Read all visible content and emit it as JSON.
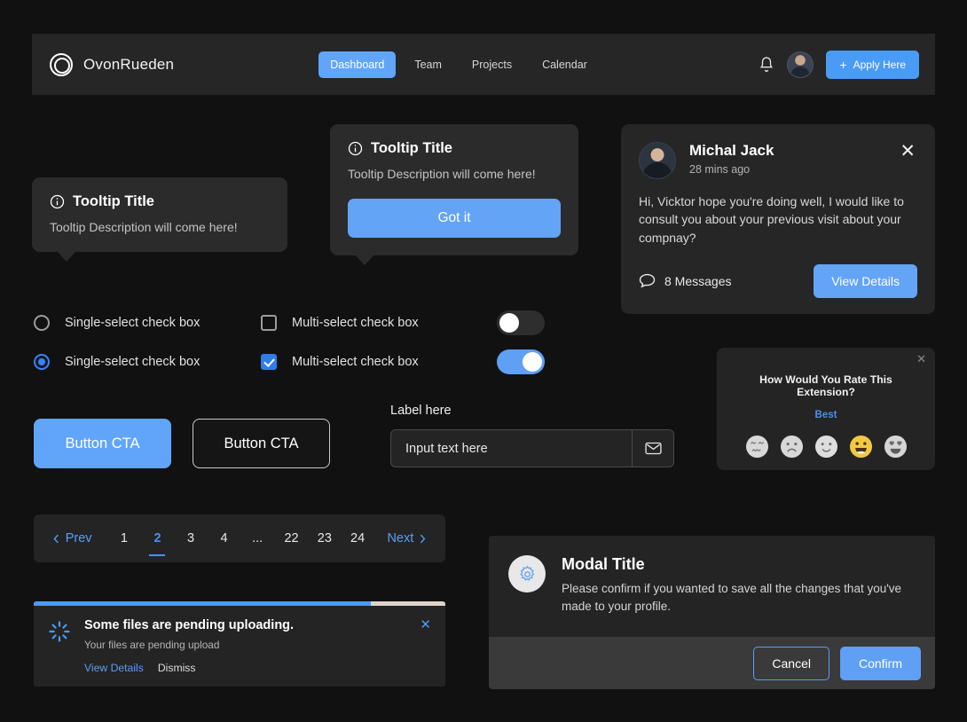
{
  "header": {
    "brand": "OvonRueden",
    "logo_icon": "circle-ring-logo-icon",
    "nav": [
      {
        "label": "Dashboard",
        "active": true
      },
      {
        "label": "Team",
        "active": false
      },
      {
        "label": "Projects",
        "active": false
      },
      {
        "label": "Calendar",
        "active": false
      }
    ],
    "bell_icon": "bell-icon",
    "avatar_icon": "user-avatar",
    "apply_label": "Apply Here",
    "apply_plus": "+"
  },
  "tooltip_simple": {
    "info_icon": "info-circle-icon",
    "title": "Tooltip Title",
    "description": "Tooltip Description will come here!"
  },
  "tooltip_action": {
    "info_icon": "info-circle-icon",
    "title": "Tooltip Title",
    "description": "Tooltip Description will come here!",
    "button_label": "Got it"
  },
  "message_card": {
    "name": "Michal Jack",
    "time": "28 mins ago",
    "close_icon": "✕",
    "body": "Hi, Vicktor hope you're doing well, I would like to consult you about your previous visit about your compnay?",
    "messages_count": "8 Messages",
    "bubble_icon": "chat-bubble-icon",
    "action_label": "View Details"
  },
  "controls": {
    "radio_off_label": "Single-select check box",
    "radio_on_label": "Single-select check box",
    "check_off_label": "Multi-select check box",
    "check_on_label": "Multi-select check box"
  },
  "rating": {
    "close_icon": "✕",
    "question": "How Would You Rate This Extension?",
    "selected_label": "Best",
    "faces": [
      {
        "name": "confounded-face-icon",
        "selected": false
      },
      {
        "name": "frowning-face-icon",
        "selected": false
      },
      {
        "name": "slight-smile-face-icon",
        "selected": false
      },
      {
        "name": "grinning-face-icon",
        "selected": true
      },
      {
        "name": "heart-eyes-face-icon",
        "selected": false
      }
    ]
  },
  "buttons": {
    "primary_label": "Button CTA",
    "secondary_label": "Button CTA"
  },
  "field": {
    "label": "Label here",
    "value": "Input text here",
    "placeholder": "Input text here",
    "addon_icon": "mail-icon"
  },
  "pagination": {
    "prev_label": "Prev",
    "next_label": "Next",
    "gap": "...",
    "pages": [
      "1",
      "2",
      "3",
      "4"
    ],
    "tail_pages": [
      "22",
      "23",
      "24"
    ],
    "active_page": "2"
  },
  "toast": {
    "progress_percent": 82,
    "spinner_icon": "loading-spinner-icon",
    "title": "Some files are pending uploading.",
    "subtitle": "Your files are pending upload",
    "view_details": "View Details",
    "dismiss": "Dismiss",
    "close_icon": "✕"
  },
  "modal": {
    "gear_icon": "gear-icon",
    "title": "Modal Title",
    "description": "Please confirm if you wanted to save all the changes that you've made to your profile.",
    "cancel_label": "Cancel",
    "confirm_label": "Confirm"
  },
  "colors": {
    "accent": "#60a5fa",
    "accent_strong": "#4a9bf5",
    "page_bg": "#111111",
    "panel_bg": "#242424",
    "header_bg": "#262626",
    "tooltip_bg": "#2b2b2b",
    "modal_footer": "#3a3a3a",
    "progress_track": "#ddd3ca"
  }
}
